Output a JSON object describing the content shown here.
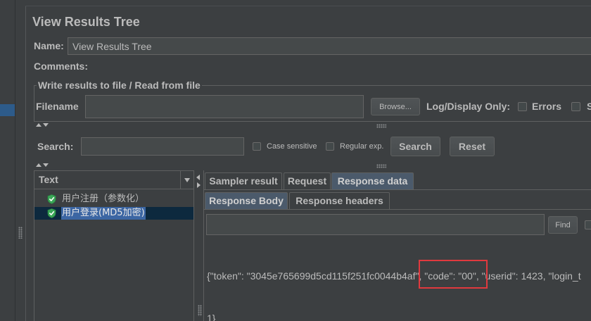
{
  "window": {
    "title": "View Results Tree"
  },
  "name_field": {
    "label": "Name:",
    "value": "View Results Tree"
  },
  "comments_field": {
    "label": "Comments:",
    "value": ""
  },
  "file_group": {
    "legend": "Write results to file / Read from file",
    "filename_label": "Filename",
    "filename_value": "",
    "browse_label": "Browse...",
    "log_display_label": "Log/Display Only:",
    "errors_label": "Errors",
    "errors_checked": false,
    "successes_label": "S",
    "successes_checked": false
  },
  "search": {
    "label": "Search:",
    "value": "",
    "case_sensitive_label": "Case sensitive",
    "case_sensitive_checked": false,
    "regex_label": "Regular exp.",
    "regex_checked": false,
    "search_button": "Search",
    "reset_button": "Reset"
  },
  "results_tree": {
    "renderer": "Text",
    "items": [
      {
        "label": "用户注册（参数化）",
        "icon": "success-shield-icon",
        "selected": false
      },
      {
        "label": "用户登录(MD5加密)",
        "icon": "success-shield-icon",
        "selected": true
      }
    ]
  },
  "tabs": {
    "items": [
      "Sampler result",
      "Request",
      "Response data"
    ],
    "selected": 2
  },
  "response_tabs": {
    "items": [
      "Response Body",
      "Response headers"
    ],
    "selected": 0
  },
  "response_find": {
    "value": "",
    "button": "Find"
  },
  "response_body": {
    "line1_before": "{\"token\": \"3045e765699d5cd115f251fc0044b4af\", ",
    "line1_highlight": "\"code\": \"00\"",
    "line1_after": ", \"userid\": 1423, \"login_t",
    "line2": "1}"
  },
  "icons": {
    "result_status": "success-shield-icon",
    "renderer_dropdown": "chevron-down-icon",
    "splitter": "splitter-grip-icon"
  },
  "colors": {
    "background": "#3c3f41",
    "text": "#bbbbbb",
    "field": "#45494a",
    "row_selection": "#0d293e",
    "label_selection": "#3c66a3",
    "tab_selected": "#4b5a6b",
    "success": "#3aa757",
    "annotation": "#e0393e"
  }
}
